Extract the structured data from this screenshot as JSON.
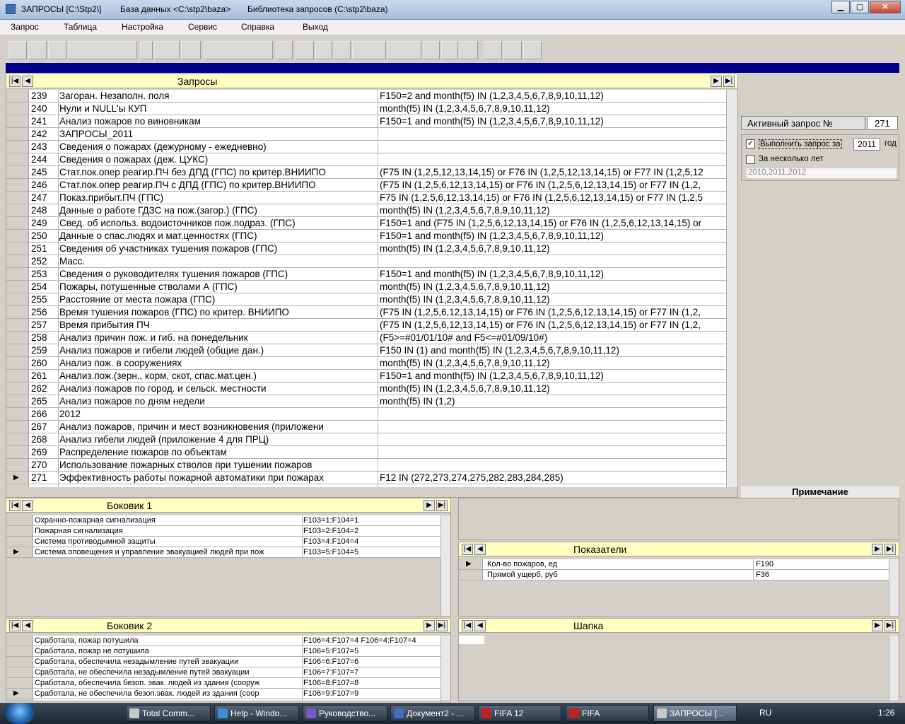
{
  "window": {
    "app_title": "ЗАПРОСЫ [C:\\Stp2\\]",
    "db_label": "База данных <C:\\stp2\\baza>",
    "lib_label": "Библиотека запросов (C:\\stp2\\baza)",
    "minimize": "▁",
    "maximize": "▢",
    "close": "✕"
  },
  "menu": [
    "Запрос",
    "Таблица",
    "Настройка",
    "Сервис",
    "Справка",
    "Выход"
  ],
  "queries": {
    "caption": "Запросы",
    "rows": [
      {
        "n": "239",
        "name": "Загоран. Незаполн. поля",
        "cond": "F150=2 and month(f5) IN (1,2,3,4,5,6,7,8,9,10,11,12)"
      },
      {
        "n": "240",
        "name": "Нули и NULL'ы КУП",
        "cond": "month(f5) IN (1,2,3,4,5,6,7,8,9,10,11,12)"
      },
      {
        "n": "241",
        "name": "Анализ пожаров по виновникам",
        "cond": "F150=1 and month(f5) IN (1,2,3,4,5,6,7,8,9,10,11,12)"
      },
      {
        "n": "242",
        "name": "ЗАПРОСЫ_2011",
        "cond": ""
      },
      {
        "n": "243",
        "name": "Сведения о пожарах (дежурному - ежедневно)",
        "cond": ""
      },
      {
        "n": "244",
        "name": "Сведения о пожарах (деж. ЦУКС)",
        "cond": ""
      },
      {
        "n": "245",
        "name": "Стат.пок.опер реагир.ПЧ без ДПД (ГПС) по критер.ВНИИПО",
        "cond": "(F75 IN (1,2,5,12,13,14,15) or F76 IN (1,2,5,12,13,14,15) or F77 IN (1,2,5,12"
      },
      {
        "n": "246",
        "name": "Стат.пок.опер реагир.ПЧ с ДПД (ГПС) по критер.ВНИИПО",
        "cond": "(F75 IN (1,2,5,6,12,13,14,15) or F76 IN (1,2,5,6,12,13,14,15) or F77 IN (1,2,"
      },
      {
        "n": "247",
        "name": "Показ.прибыт.ПЧ (ГПС)",
        "cond": "F75 IN (1,2,5,6,12,13,14,15) or F76 IN (1,2,5,6,12,13,14,15) or F77 IN (1,2,5"
      },
      {
        "n": "248",
        "name": "Данные о работе ГДЗС на пож.(загор.) (ГПС)",
        "cond": "month(f5) IN (1,2,3,4,5,6,7,8,9,10,11,12)"
      },
      {
        "n": "249",
        "name": "Свед. об использ. водоисточников пож.подраз. (ГПС)",
        "cond": "F150=1 and (F75 IN (1,2,5,6,12,13,14,15) or F76 IN (1,2,5,6,12,13,14,15) or"
      },
      {
        "n": "250",
        "name": "Данные о спас.людях и мат.ценностях (ГПС)",
        "cond": "F150=1 and month(f5) IN (1,2,3,4,5,6,7,8,9,10,11,12)"
      },
      {
        "n": "251",
        "name": "Сведения об участниках тушения пожаров (ГПС)",
        "cond": "month(f5) IN (1,2,3,4,5,6,7,8,9,10,11,12)"
      },
      {
        "n": "252",
        "name": "Масс.",
        "cond": ""
      },
      {
        "n": "253",
        "name": "Сведения о руководителях тушения пожаров (ГПС)",
        "cond": "F150=1 and month(f5) IN (1,2,3,4,5,6,7,8,9,10,11,12)"
      },
      {
        "n": "254",
        "name": "Пожары, потушенные стволами А (ГПС)",
        "cond": "month(f5) IN (1,2,3,4,5,6,7,8,9,10,11,12)"
      },
      {
        "n": "255",
        "name": "Расстояние от места пожара (ГПС)",
        "cond": "month(f5) IN (1,2,3,4,5,6,7,8,9,10,11,12)"
      },
      {
        "n": "256",
        "name": "Время тушения пожаров (ГПС) по критер. ВНИИПО",
        "cond": "(F75 IN (1,2,5,6,12,13,14,15) or F76 IN (1,2,5,6,12,13,14,15) or F77 IN (1,2,"
      },
      {
        "n": "257",
        "name": "Время прибытия ПЧ",
        "cond": "(F75 IN (1,2,5,6,12,13,14,15) or F76 IN (1,2,5,6,12,13,14,15) or F77 IN (1,2,"
      },
      {
        "n": "258",
        "name": "Анализ причин пож. и гиб. на понедельник",
        "cond": "(F5>=#01/01/10# and F5<=#01/09/10#)"
      },
      {
        "n": "259",
        "name": "Анализ пожаров и гибели людей (общие дан.)",
        "cond": "F150 IN (1) and month(f5) IN (1,2,3,4,5,6,7,8,9,10,11,12)"
      },
      {
        "n": "260",
        "name": "Анализ пож. в сооружениях",
        "cond": "month(f5) IN (1,2,3,4,5,6,7,8,9,10,11,12)"
      },
      {
        "n": "261",
        "name": "Анализ.пож.(зерн., корм, скот, спас.мат.цен.)",
        "cond": "F150=1 and month(f5) IN (1,2,3,4,5,6,7,8,9,10,11,12)"
      },
      {
        "n": "262",
        "name": "Анализ пожаров по город. и сельск. местности",
        "cond": "month(f5) IN (1,2,3,4,5,6,7,8,9,10,11,12)"
      },
      {
        "n": "265",
        "name": "Анализ пожаров по дням недели",
        "cond": "month(f5) IN (1,2)"
      },
      {
        "n": "266",
        "name": "2012",
        "cond": ""
      },
      {
        "n": "267",
        "name": "Анализ пожаров, причин и мест возникновения (приложени",
        "cond": ""
      },
      {
        "n": "268",
        "name": "Анализ гибели людей (приложение 4 для ПРЦ)",
        "cond": ""
      },
      {
        "n": "269",
        "name": "Распределение пожаров по объектам",
        "cond": ""
      },
      {
        "n": "270",
        "name": "Использование пожарных стволов при тушении пожаров",
        "cond": ""
      },
      {
        "n": "271",
        "name": "Эффективность работы пожарной автоматики при пожарах",
        "cond": "F12 IN (272,273,274,275,282,283,284,285)"
      }
    ]
  },
  "side": {
    "active_label": "Активный запрос №",
    "active_value": "271",
    "run_label": "Выполнить запрос за",
    "year_value": "2011",
    "year_suffix": "год",
    "multi_label": "За несколько лет",
    "years_value": "2010,2011,2012",
    "note_label": "Примечание"
  },
  "bokovik1": {
    "caption": "Боковик 1",
    "rows": [
      {
        "name": "Охранно-пожарная сигнализация",
        "cond": "F103=1:F104=1"
      },
      {
        "name": "Пожарная сигнализация",
        "cond": "F103=2:F104=2"
      },
      {
        "name": "Система противодымной защиты",
        "cond": "F103=4:F104=4"
      },
      {
        "name": "Система оповещения и управление эвакуацией людей при пож",
        "cond": "F103=5:F104=5"
      }
    ]
  },
  "pokazateli": {
    "caption": "Показатели",
    "rows": [
      {
        "name": "Кол-во пожаров, ед",
        "cond": "F190"
      },
      {
        "name": "Прямой ущерб, руб",
        "cond": "F36"
      }
    ]
  },
  "bokovik2": {
    "caption": "Боковик 2",
    "rows": [
      {
        "name": "Сработала, пожар потушила",
        "cond": "F106=4:F107=4 F106=4:F107=4"
      },
      {
        "name": "Сработала, пожар не потушила",
        "cond": "F106=5:F107=5"
      },
      {
        "name": "Сработала, обеспечила незадымление путей эвакуации",
        "cond": "F106=6:F107=6"
      },
      {
        "name": "Сработала, не обеспечила незадымление путей эвакуации",
        "cond": "F106=7:F107=7"
      },
      {
        "name": "Сработала, обеспечила безоп. эвак. людей из здания (сооруж",
        "cond": "F106=8:F107=8"
      },
      {
        "name": "Сработала, не обеспечила безоп.эвак. людей из здания (соор",
        "cond": "F106=9:F107=9"
      }
    ]
  },
  "shapka": {
    "caption": "Шапка"
  },
  "taskbar": {
    "tasks": [
      "Total Comm...",
      "Help - Windo...",
      "Руководство...",
      "Документ2 - ...",
      "FIFA 12",
      "FIFA",
      "ЗАПРОСЫ [..."
    ],
    "lang": "RU",
    "clock": "1:26"
  }
}
